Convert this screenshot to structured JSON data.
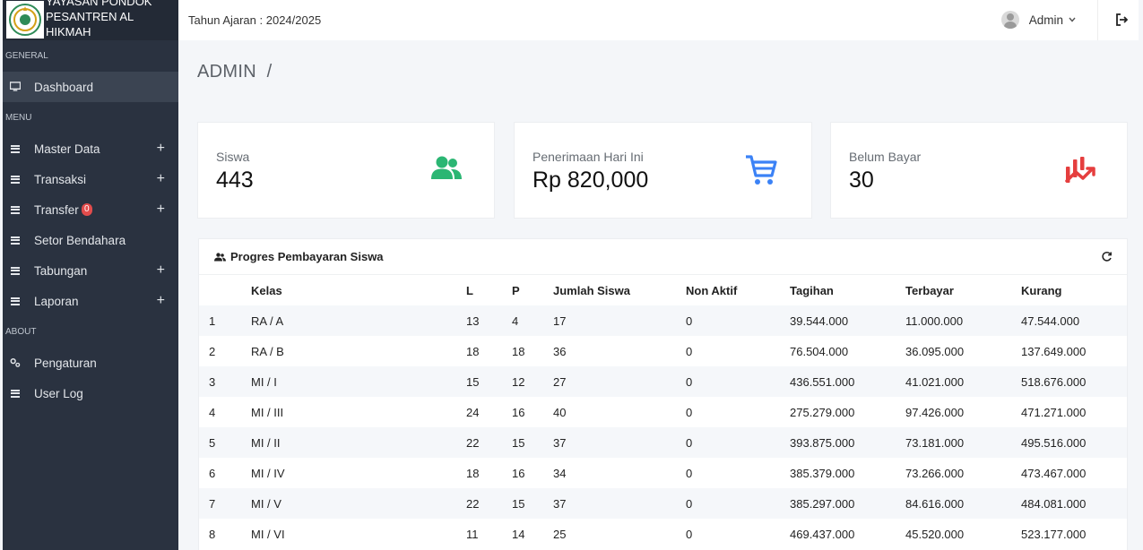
{
  "brand": {
    "line1": "YAYASAN PONDOK",
    "line2": "PESANTREN AL",
    "line3": "HIKMAH"
  },
  "sidebar": {
    "sections": [
      "GENERAL",
      "MENU",
      "ABOUT"
    ],
    "dashboard": "Dashboard",
    "menu": [
      {
        "label": "Master Data",
        "expand": "+"
      },
      {
        "label": "Transaksi",
        "expand": "+"
      },
      {
        "label": "Transfer",
        "badge": "0",
        "expand": "+"
      },
      {
        "label": "Setor Bendahara"
      },
      {
        "label": "Tabungan",
        "expand": "+"
      },
      {
        "label": "Laporan",
        "expand": "+"
      }
    ],
    "about": [
      {
        "label": "Pengaturan"
      },
      {
        "label": "User Log"
      }
    ]
  },
  "topbar": {
    "year": "Tahun Ajaran : 2024/2025",
    "user": "Admin"
  },
  "page_title": "ADMIN  /",
  "cards": [
    {
      "label": "Siswa",
      "value": "443",
      "icon": "users-icon",
      "color": "#2bb673"
    },
    {
      "label": "Penerimaan Hari Ini",
      "value": "Rp 820,000",
      "icon": "cart-icon",
      "color": "#3b82f6"
    },
    {
      "label": "Belum Bayar",
      "value": "30",
      "icon": "chart-down-icon",
      "color": "#e53e3e"
    }
  ],
  "panel": {
    "title": "Progres Pembayaran Siswa",
    "columns": [
      "",
      "Kelas",
      "L",
      "P",
      "Jumlah Siswa",
      "Non Aktif",
      "Tagihan",
      "Terbayar",
      "Kurang"
    ],
    "rows": [
      [
        "1",
        "RA / A",
        "13",
        "4",
        "17",
        "0",
        "39.544.000",
        "11.000.000",
        "47.544.000"
      ],
      [
        "2",
        "RA / B",
        "18",
        "18",
        "36",
        "0",
        "76.504.000",
        "36.095.000",
        "137.649.000"
      ],
      [
        "3",
        "MI / I",
        "15",
        "12",
        "27",
        "0",
        "436.551.000",
        "41.021.000",
        "518.676.000"
      ],
      [
        "4",
        "MI / III",
        "24",
        "16",
        "40",
        "0",
        "275.279.000",
        "97.426.000",
        "471.271.000"
      ],
      [
        "5",
        "MI / II",
        "22",
        "15",
        "37",
        "0",
        "393.875.000",
        "73.181.000",
        "495.516.000"
      ],
      [
        "6",
        "MI / IV",
        "18",
        "16",
        "34",
        "0",
        "385.379.000",
        "73.266.000",
        "473.467.000"
      ],
      [
        "7",
        "MI / V",
        "22",
        "15",
        "37",
        "0",
        "385.297.000",
        "84.616.000",
        "484.081.000"
      ],
      [
        "8",
        "MI / VI",
        "11",
        "14",
        "25",
        "0",
        "469.437.000",
        "45.520.000",
        "523.177.000"
      ]
    ]
  }
}
